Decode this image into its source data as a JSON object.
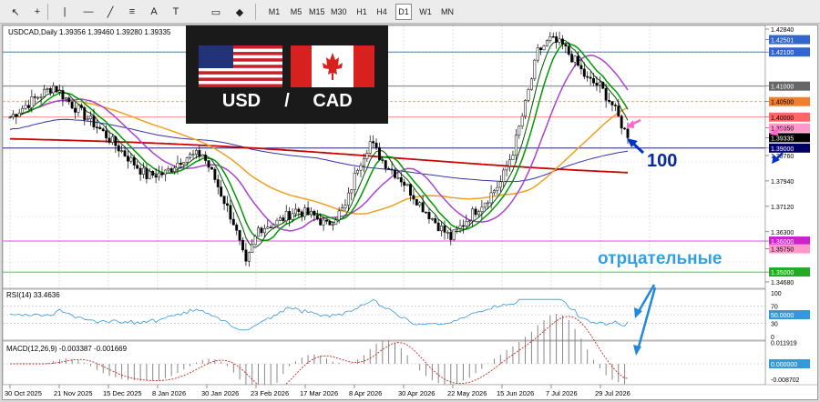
{
  "toolbar": {
    "timeframes": [
      {
        "label": "M1",
        "active": false
      },
      {
        "label": "M5",
        "active": false
      },
      {
        "label": "M15",
        "active": false
      },
      {
        "label": "M30",
        "active": false
      },
      {
        "label": "H1",
        "active": false
      },
      {
        "label": "H4",
        "active": false
      },
      {
        "label": "D1",
        "active": true
      },
      {
        "label": "W1",
        "active": false
      },
      {
        "label": "MN",
        "active": false
      }
    ],
    "tools": [
      "cursor-icon",
      "crosshair-icon",
      "vertical-line-icon",
      "horizontal-line-icon",
      "trendline-icon",
      "channel-icon",
      "text-icon",
      "label-icon",
      "rectangle-icon",
      "shapes-icon"
    ]
  },
  "chart": {
    "symbol_info": "USDCAD,Daily  1.39356 1.39460 1.39280 1.39335",
    "banner": {
      "left": "USD",
      "sep": "/",
      "right": "CAD"
    },
    "annotations": {
      "ma_period": "100",
      "negative": "отрцательные"
    },
    "price_ticks": [
      "1.42840",
      "1.42501",
      "1.42100",
      "1.41000",
      "1.40500",
      "1.40000",
      "1.39650",
      "1.39335",
      "1.39000",
      "1.38760",
      "1.37940",
      "1.37120",
      "1.36300",
      "1.36000",
      "1.35750",
      "1.35000",
      "1.34680"
    ],
    "current_price": "1.39335",
    "date_ticks": [
      "30 Oct 2025",
      "21 Nov 2025",
      "15 Dec 2025",
      "8 Jan 2026",
      "30 Jan 2026",
      "23 Feb 2026",
      "17 Mar 2026",
      "8 Apr 2026",
      "30 Apr 2026",
      "22 May 2026",
      "15 Jun 2026",
      "7 Jul 2026",
      "29 Jul 2026"
    ],
    "colors": {
      "bull": "#000000",
      "bear": "#000000",
      "ma_fast": "#009900",
      "ma_mid": "#aa44cc",
      "ma_slow": "#f0a020",
      "ma_red": "#cc0000",
      "ma_blue": "#3333aa",
      "arrow_pink": "#ff66cc",
      "arrow_blue": "#0033cc"
    }
  },
  "rsi": {
    "label": "RSI(14) 33.4636",
    "ticks": [
      "100",
      "70",
      "50.0000",
      "30",
      "0"
    ]
  },
  "macd": {
    "label": "MACD(12,26,9) -0.003387 -0.001669",
    "ticks": [
      "0.011919",
      "0.000000",
      "-0.008702"
    ]
  },
  "chart_data": {
    "type": "candlestick",
    "title": "USDCAD,Daily",
    "ylim": [
      1.3468,
      1.4284
    ],
    "x": [
      "30 Oct 2025",
      "21 Nov 2025",
      "15 Dec 2025",
      "8 Jan 2026",
      "30 Jan 2026",
      "23 Feb 2026",
      "17 Mar 2026",
      "8 Apr 2026",
      "30 Apr 2026",
      "22 May 2026",
      "15 Jun 2026",
      "7 Jul 2026",
      "29 Jul 2026",
      "4 Aug 2026"
    ],
    "series": [
      {
        "name": "close",
        "values": [
          1.404,
          1.409,
          1.384,
          1.388,
          1.366,
          1.371,
          1.392,
          1.369,
          1.364,
          1.381,
          1.423,
          1.411,
          1.399,
          1.3934
        ]
      }
    ],
    "last": {
      "open": 1.39356,
      "high": 1.3946,
      "low": 1.3928,
      "close": 1.39335
    },
    "rsi_last": 33.4636,
    "macd_last": [
      -0.003387,
      -0.001669
    ]
  }
}
